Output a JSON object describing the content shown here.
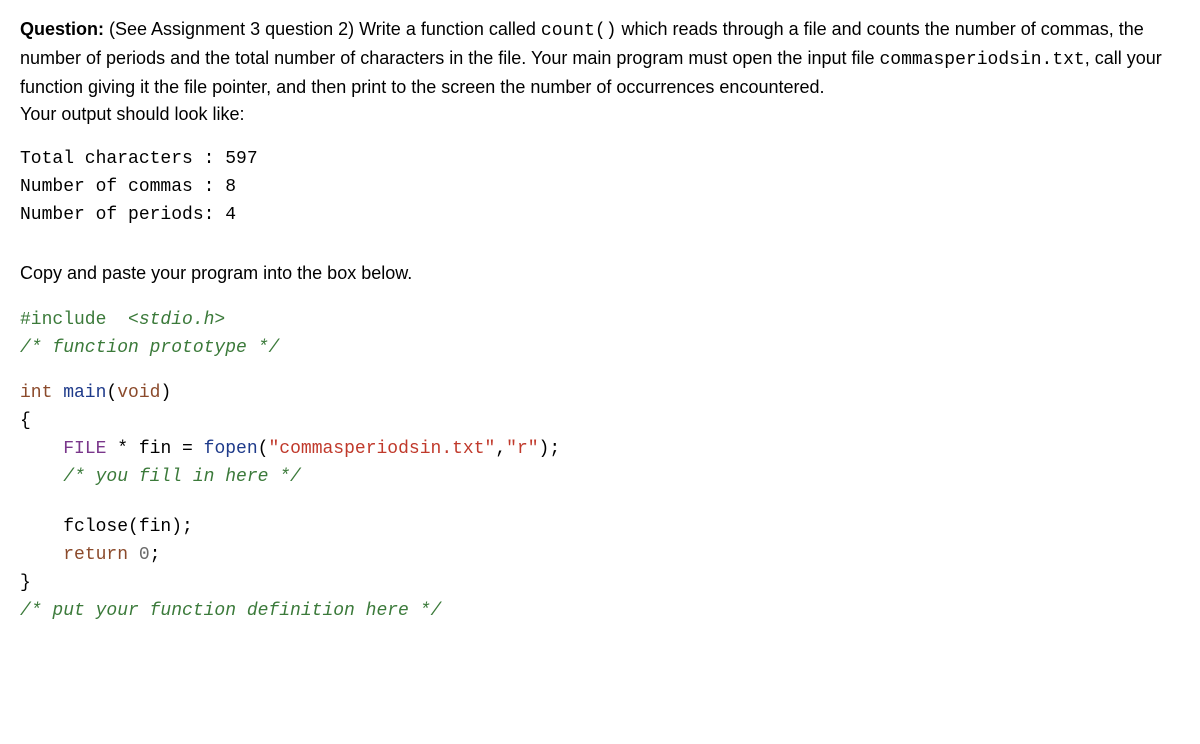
{
  "question": {
    "label": "Question:",
    "body_part1": " (See Assignment 3 question 2) Write a function called ",
    "fn_name": "count()",
    "body_part2": " which reads through a file and counts the number of commas, the number of periods and the total number of characters in the file. Your main program must open the input file ",
    "filename": "commasperiodsin.txt",
    "body_part3": ", call your function giving it the file pointer, and then print to the screen the number of occurrences encountered.",
    "tail": "Your output should look like:"
  },
  "output": {
    "line1": "Total characters : 597",
    "line2": "Number of commas : 8",
    "line3": "Number of periods: 4"
  },
  "instruction": "Copy and paste your program into the box below.",
  "code": {
    "include_dir": "#include ",
    "include_hdr": " <stdio.h>",
    "proto_comment": "/* function prototype */",
    "int_kw": "int",
    "main_fn": " main",
    "main_args_open": "(",
    "void_kw": "void",
    "main_args_close": ")",
    "lbrace": "{",
    "indent": "    ",
    "file_type": "FILE",
    "star_fin_eq": " * fin = ",
    "fopen_fn": "fopen",
    "open_paren": "(",
    "str_file": "\"commasperiodsin.txt\"",
    "comma": ",",
    "str_mode": "\"r\"",
    "close_paren_semi": ");",
    "fill_comment": "/* you fill in here */",
    "fclose_call": "fclose(fin);",
    "return_kw": "return",
    "space": " ",
    "zero": "0",
    "semi": ";",
    "rbrace": "}",
    "def_comment": "/* put your function definition here */"
  }
}
